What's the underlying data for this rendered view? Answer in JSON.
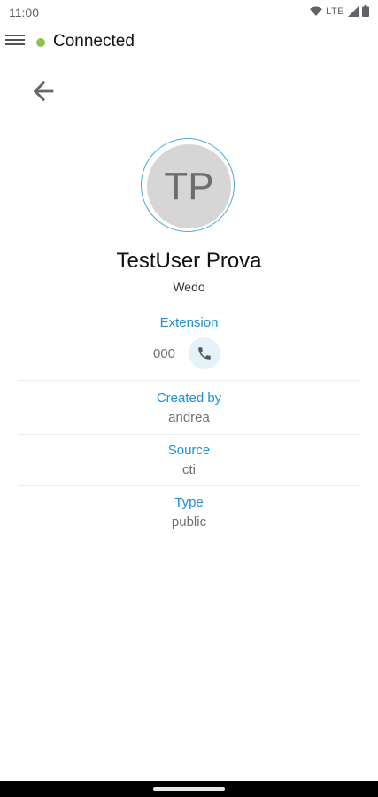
{
  "status_bar": {
    "time": "11:00",
    "network": "LTE",
    "icons": [
      "wifi-icon",
      "signal-icon",
      "battery-icon"
    ]
  },
  "app_bar": {
    "connection_status": "Connected",
    "status_color": "#8bc34a",
    "menu_icon": "hamburger-menu-icon"
  },
  "back_icon": "arrow-back-icon",
  "contact": {
    "initials": "TP",
    "name": "TestUser Prova",
    "company": "Wedo"
  },
  "fields": {
    "extension": {
      "label": "Extension",
      "value": "000",
      "action_icon": "phone-icon"
    },
    "created_by": {
      "label": "Created by",
      "value": "andrea"
    },
    "source": {
      "label": "Source",
      "value": "cti"
    },
    "type": {
      "label": "Type",
      "value": "public"
    }
  },
  "colors": {
    "accent": "#1e90d6",
    "avatar_bg": "#d6d6d6",
    "value_text": "#707070"
  }
}
